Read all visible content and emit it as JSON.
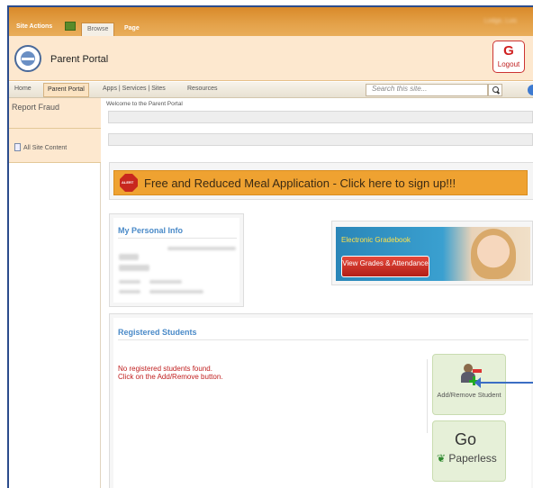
{
  "ribbon": {
    "site_actions": "Site Actions",
    "tab_browse": "Browse",
    "tab_page": "Page",
    "user": "Lodge, Luis"
  },
  "header": {
    "title": "Parent Portal",
    "logout_label": "Logout"
  },
  "topnav": {
    "items": [
      "Home",
      "Parent Portal",
      "Apps | Services | Sites",
      "Resources"
    ],
    "search_placeholder": "Search this site..."
  },
  "leftnav": {
    "report_fraud": "Report Fraud",
    "all_site_content": "All Site Content"
  },
  "main": {
    "welcome": "Welcome to the Parent Portal",
    "alert_banner": "Free and Reduced Meal Application - Click here to sign up!!!",
    "personal_info_title": "My Personal Info",
    "gradebook_title": "Electronic Gradebook",
    "gradebook_button": "View Grades & Attendance",
    "registered_title": "Registered Students",
    "no_students_line1": "No registered students found.",
    "no_students_line2": "Click on the Add/Remove button.",
    "add_remove_label": "Add/Remove Student",
    "go_label": "Go",
    "paperless_label": "Paperless"
  },
  "colors": {
    "ribbon_orange": "#e4a24a",
    "header_bg": "#fde8cf",
    "accent_blue": "#4a8ac8",
    "alert_orange": "#efa231",
    "error_red": "#c02020"
  }
}
